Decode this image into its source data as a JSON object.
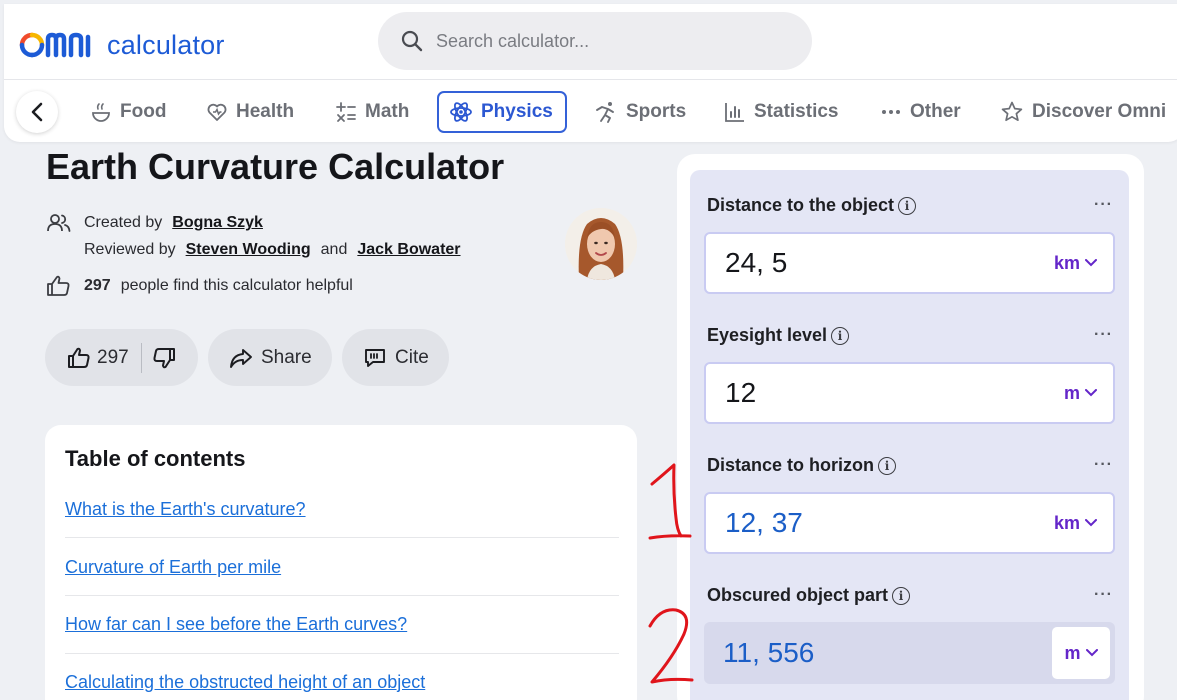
{
  "header": {
    "logo_text": "calculator",
    "search_placeholder": "Search calculator..."
  },
  "nav": {
    "items": [
      {
        "label": "Food",
        "icon": "food-icon"
      },
      {
        "label": "Health",
        "icon": "health-icon"
      },
      {
        "label": "Math",
        "icon": "math-icon"
      },
      {
        "label": "Physics",
        "icon": "physics-icon",
        "active": true
      },
      {
        "label": "Sports",
        "icon": "sports-icon"
      },
      {
        "label": "Statistics",
        "icon": "statistics-icon"
      },
      {
        "label": "Other",
        "icon": "other-icon"
      },
      {
        "label": "Discover Omni",
        "icon": "star-icon"
      }
    ]
  },
  "article": {
    "title": "Earth Curvature Calculator",
    "created_prefix": "Created by",
    "author": "Bogna Szyk",
    "reviewed_prefix": "Reviewed by",
    "reviewer1": "Steven Wooding",
    "and_word": "and",
    "reviewer2": "Jack Bowater",
    "helpful_count": "297",
    "helpful_text": "people find this calculator helpful",
    "like_count": "297",
    "share_label": "Share",
    "cite_label": "Cite"
  },
  "toc": {
    "title": "Table of contents",
    "links": [
      "What is the Earth's curvature?",
      "Curvature of Earth per mile",
      "How far can I see before the Earth curves?",
      "Calculating the obstructed height of an object"
    ]
  },
  "calculator": {
    "fields": [
      {
        "label": "Distance to the object",
        "value": "24, 5",
        "unit": "km"
      },
      {
        "label": "Eyesight level",
        "value": "12",
        "unit": "m"
      },
      {
        "label": "Distance to horizon",
        "value": "12, 37",
        "unit": "km"
      },
      {
        "label": "Obscured object part",
        "value": "11, 556",
        "unit": "m"
      }
    ],
    "more_symbol": "···",
    "info_symbol": "i"
  },
  "annotations": {
    "marker1": "1",
    "marker2": "2"
  },
  "colors": {
    "accent": "#2c58d2",
    "unit": "#6426c9",
    "link": "#1b6fd9",
    "annotation": "#e0151b"
  }
}
